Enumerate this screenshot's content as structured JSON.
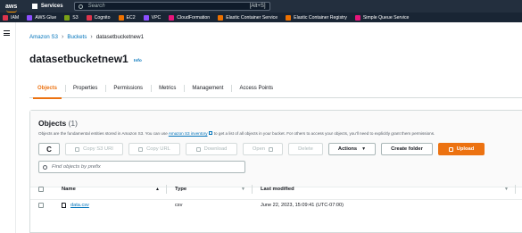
{
  "topnav": {
    "logo_text": "aws",
    "services_label": "Services",
    "search_placeholder": "Search",
    "search_shortcut": "[Alt+S]"
  },
  "favorites": [
    {
      "label": "IAM",
      "color": "#dd344c"
    },
    {
      "label": "AWS Glue",
      "color": "#8c4fff"
    },
    {
      "label": "S3",
      "color": "#7aa116"
    },
    {
      "label": "Cognito",
      "color": "#dd344c"
    },
    {
      "label": "EC2",
      "color": "#ed7100"
    },
    {
      "label": "VPC",
      "color": "#8c4fff"
    },
    {
      "label": "CloudFormation",
      "color": "#e7157b"
    },
    {
      "label": "Elastic Container Service",
      "color": "#ed7100"
    },
    {
      "label": "Elastic Container Registry",
      "color": "#ed7100"
    },
    {
      "label": "Simple Queue Service",
      "color": "#e7157b"
    }
  ],
  "breadcrumb": {
    "items": [
      "Amazon S3",
      "Buckets"
    ],
    "current": "datasetbucketnew1"
  },
  "page": {
    "title": "datasetbucketnew1",
    "info_label": "Info"
  },
  "tabs": [
    {
      "label": "Objects",
      "active": true
    },
    {
      "label": "Properties",
      "active": false
    },
    {
      "label": "Permissions",
      "active": false
    },
    {
      "label": "Metrics",
      "active": false
    },
    {
      "label": "Management",
      "active": false
    },
    {
      "label": "Access Points",
      "active": false
    }
  ],
  "objects": {
    "title": "Objects",
    "count": "(1)",
    "desc_before": "Objects are the fundamental entities stored in Amazon S3. You can use ",
    "desc_link": "Amazon S3 inventory",
    "desc_after": " to get a list of all objects in your bucket. For others to access your objects, you'll need to explicitly grant them permissions.",
    "buttons": {
      "refresh": "C",
      "copy_s3_uri": "Copy S3 URI",
      "copy_url": "Copy URL",
      "download": "Download",
      "open": "Open",
      "delete": "Delete",
      "actions": "Actions",
      "create_folder": "Create folder",
      "upload": "Upload"
    },
    "filter_placeholder": "Find objects by prefix",
    "columns": {
      "name": "Name",
      "type": "Type",
      "last_modified": "Last modified"
    },
    "rows": [
      {
        "name": "data.csv",
        "type": "csv",
        "last_modified": "June 22, 2023, 15:09:41 (UTC-07:00)"
      }
    ]
  },
  "colors": {
    "accent": "#ec7211",
    "link": "#0073bb",
    "nav_bg": "#232f3e"
  }
}
